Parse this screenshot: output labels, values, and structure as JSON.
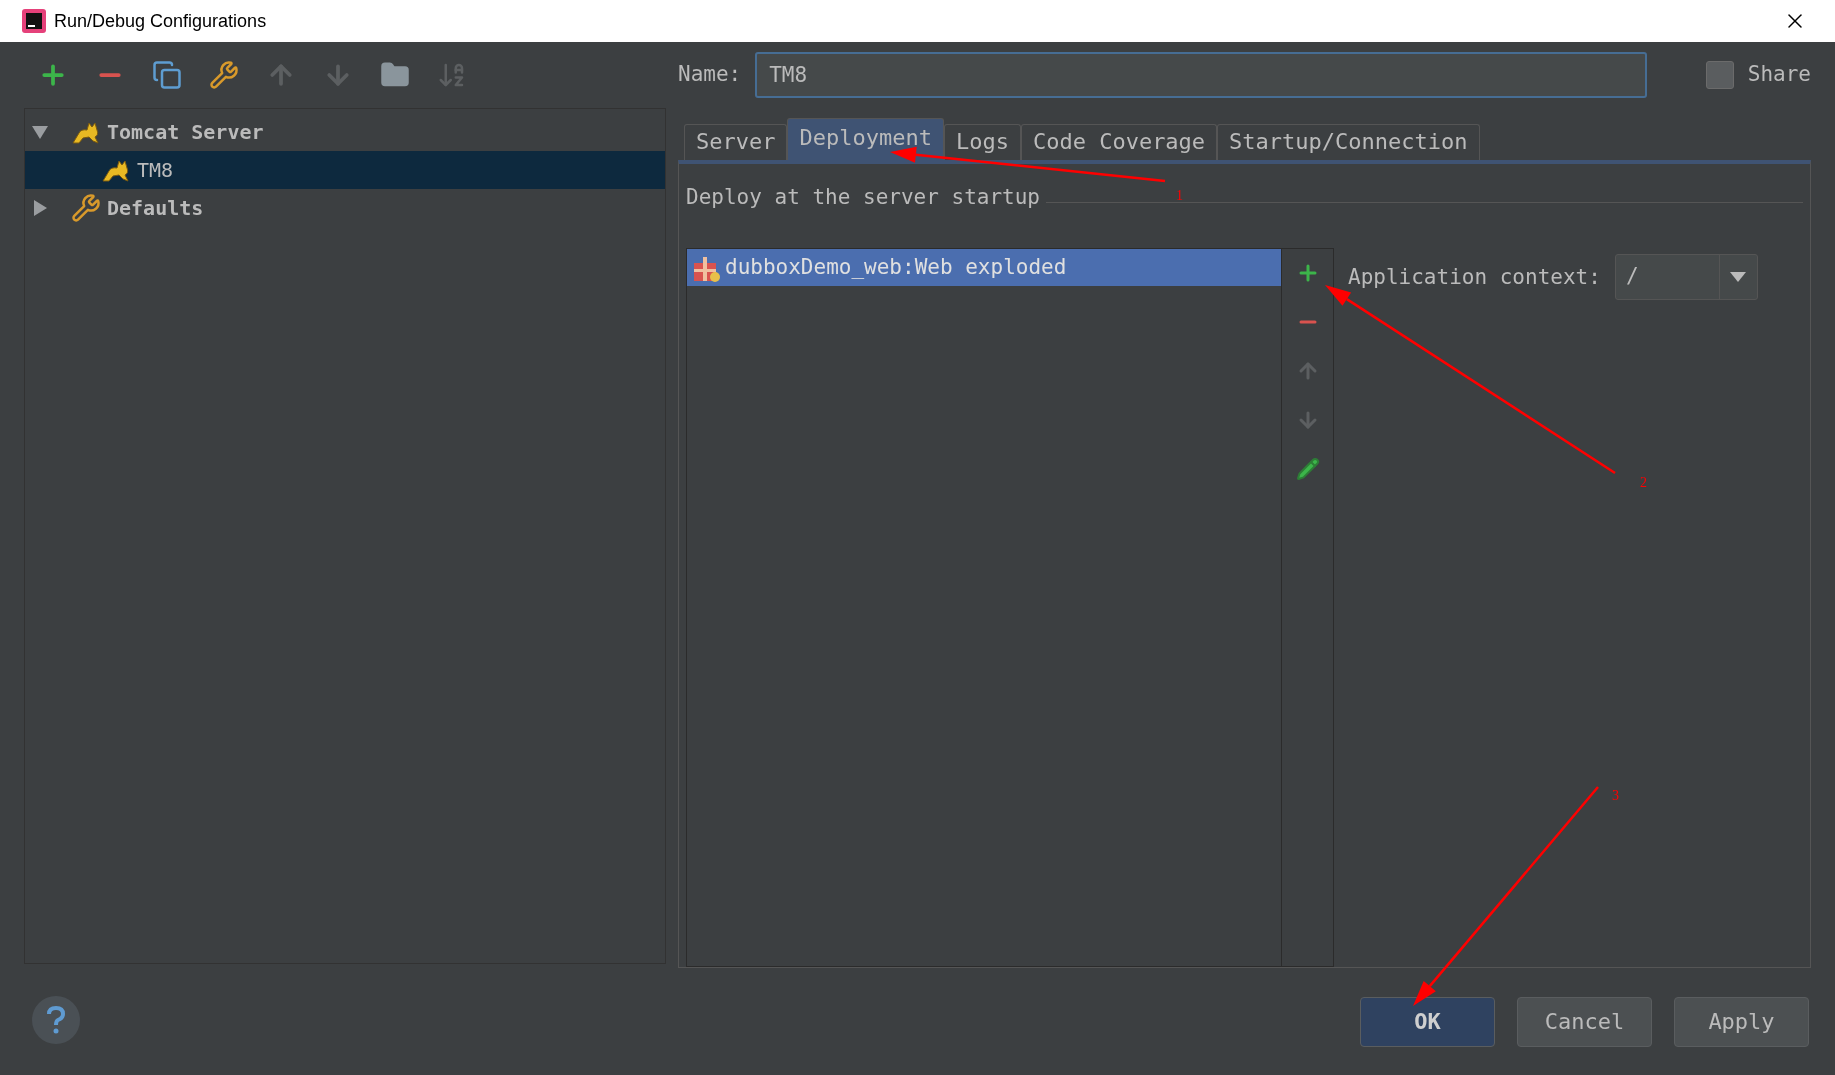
{
  "window": {
    "title": "Run/Debug Configurations"
  },
  "toolbar": [
    {
      "kind": "add",
      "disabled": false
    },
    {
      "kind": "remove",
      "disabled": false
    },
    {
      "kind": "copy",
      "disabled": false
    },
    {
      "kind": "edit-defaults",
      "disabled": false
    },
    {
      "kind": "up",
      "disabled": true
    },
    {
      "kind": "down",
      "disabled": true
    },
    {
      "kind": "folder",
      "disabled": false
    },
    {
      "kind": "sort",
      "disabled": true
    }
  ],
  "tree": [
    {
      "label": "Tomcat Server",
      "kind": "tomcat",
      "expanded": true,
      "selected": false,
      "children": [
        {
          "label": "TM8",
          "kind": "tomcat",
          "selected": true
        }
      ]
    },
    {
      "label": "Defaults",
      "kind": "defaults",
      "expanded": false,
      "selected": false
    }
  ],
  "name_field": {
    "label": "Name:",
    "value": "TM8"
  },
  "share": {
    "label": "Share",
    "checked": false
  },
  "tabs": [
    {
      "label": "Server",
      "selected": false
    },
    {
      "label": "Deployment",
      "selected": true
    },
    {
      "label": "Logs",
      "selected": false
    },
    {
      "label": "Code Coverage",
      "selected": false
    },
    {
      "label": "Startup/Connection",
      "selected": false
    }
  ],
  "deployment": {
    "heading": "Deploy at the server startup",
    "artifacts": [
      {
        "label": "dubboxDemo_web:Web exploded",
        "selected": true
      }
    ],
    "side_toolbar": [
      {
        "kind": "add",
        "disabled": false
      },
      {
        "kind": "remove",
        "disabled": false
      },
      {
        "kind": "up",
        "disabled": true
      },
      {
        "kind": "down",
        "disabled": true
      },
      {
        "kind": "edit",
        "disabled": false
      }
    ],
    "context": {
      "label": "Application context:",
      "value": "/"
    }
  },
  "buttons": [
    {
      "label": "OK",
      "kind": "default"
    },
    {
      "label": "Cancel",
      "kind": "normal"
    },
    {
      "label": "Apply",
      "kind": "normal"
    }
  ],
  "annotations": [
    {
      "label": "1"
    },
    {
      "label": "2"
    },
    {
      "label": "3"
    }
  ]
}
